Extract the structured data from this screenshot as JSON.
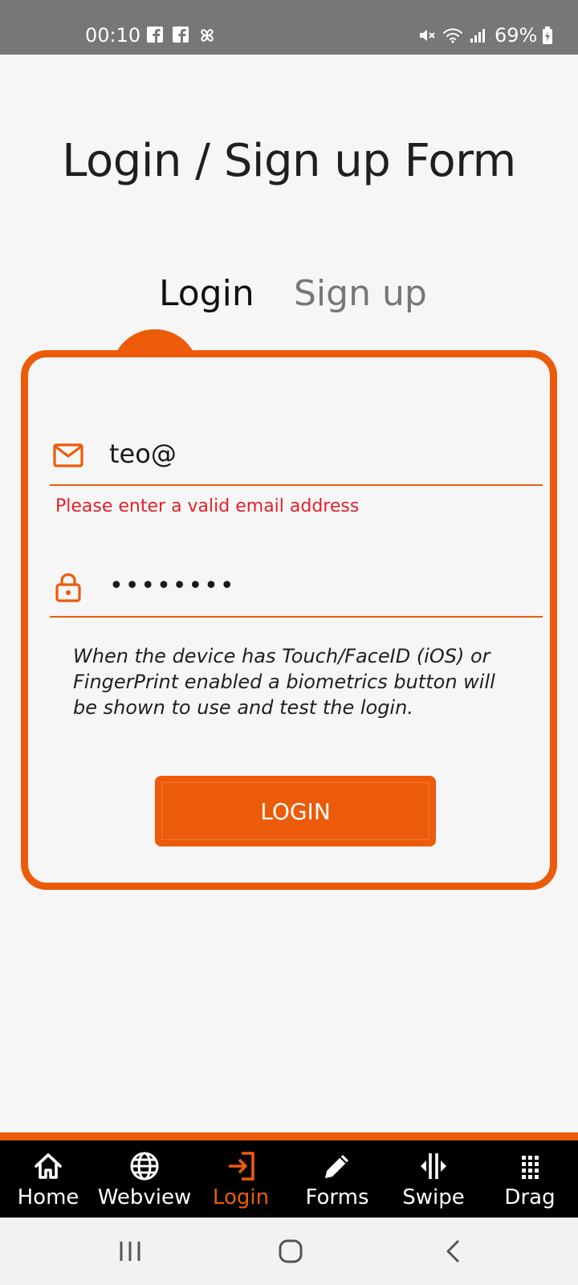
{
  "status_bar": {
    "time": "00:10",
    "battery": "69%",
    "left_icons": [
      "facebook-icon",
      "facebook-icon",
      "pinwheel-icon"
    ],
    "right_icons": [
      "mute-icon",
      "wifi-icon",
      "signal-icon",
      "battery-charging-icon"
    ]
  },
  "page": {
    "title": "Login / Sign up Form"
  },
  "tabs": [
    {
      "label": "Login",
      "active": true
    },
    {
      "label": "Sign up",
      "active": false
    }
  ],
  "form": {
    "email": {
      "value": "teo@",
      "icon": "mail-icon"
    },
    "email_error": "Please enter a valid email address",
    "password": {
      "value": "••••••••",
      "icon": "lock-icon"
    },
    "info": "When the device has Touch/FaceID (iOS) or FingerPrint enabled a biometrics button will be shown to use and test the login.",
    "submit_label": "LOGIN"
  },
  "bottom_nav": {
    "items": [
      {
        "label": "Home",
        "icon": "home-icon"
      },
      {
        "label": "Webview",
        "icon": "globe-icon"
      },
      {
        "label": "Login",
        "icon": "login-icon",
        "active": true
      },
      {
        "label": "Forms",
        "icon": "pencil-icon"
      },
      {
        "label": "Swipe",
        "icon": "swipe-icon"
      },
      {
        "label": "Drag",
        "icon": "grid-icon"
      }
    ]
  },
  "colors": {
    "accent": "#ec5b0a",
    "error": "#e3202a",
    "background": "#f6f6f6",
    "status_bar": "#777777",
    "tab_inactive": "#777777"
  }
}
